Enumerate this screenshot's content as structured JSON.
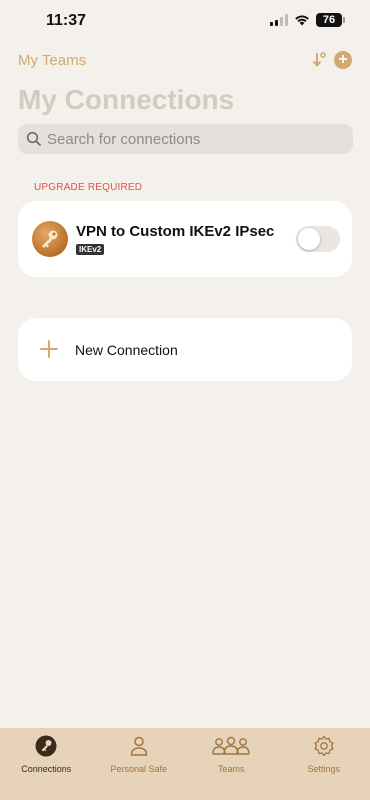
{
  "status_bar": {
    "time": "11:37",
    "battery": "76"
  },
  "nav": {
    "back_label": "My Teams",
    "sort_icon": "sort-icon",
    "add_icon": "plus-circle-icon"
  },
  "title": "My Connections",
  "search": {
    "placeholder": "Search for connections",
    "value": ""
  },
  "upgrade_label": "UPGRADE REQUIRED",
  "connections": [
    {
      "name": "VPN to Custom IKEv2 IPsec",
      "protocol": "IKEv2",
      "enabled": false,
      "icon": "key-icon"
    }
  ],
  "new_connection_label": "New Connection",
  "tabs": [
    {
      "label": "Connections",
      "icon": "key-icon",
      "active": true
    },
    {
      "label": "Personal Safe",
      "icon": "person-icon",
      "active": false
    },
    {
      "label": "Teams",
      "icon": "people-icon",
      "active": false
    },
    {
      "label": "Settings",
      "icon": "gear-icon",
      "active": false
    }
  ],
  "colors": {
    "accent": "#d3a872",
    "background": "#f4f0ec",
    "tabbar": "#e6d3b9",
    "warning": "#e0533d"
  }
}
